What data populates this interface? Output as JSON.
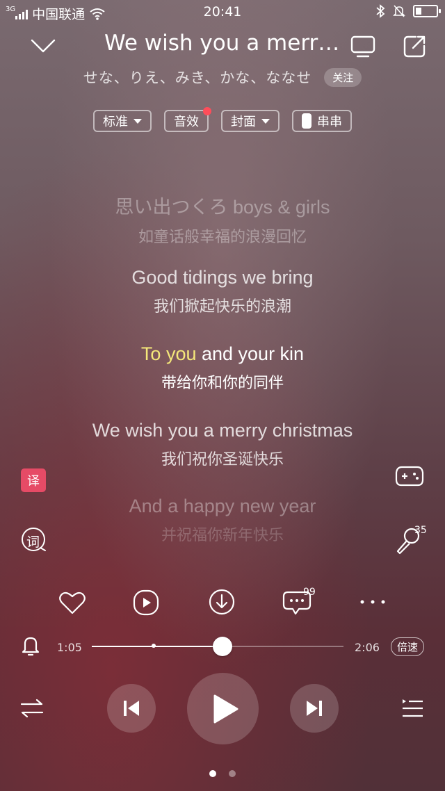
{
  "status": {
    "network": "3G",
    "carrier": "中国联通",
    "time": "20:41",
    "battery_level": 0.3
  },
  "header": {
    "title": "We wish you a merry christmas",
    "artist": "せな、りえ、みき、かな、ななせ",
    "follow_label": "关注"
  },
  "chips": {
    "quality": "标准",
    "effect": "音效",
    "cover": "封面",
    "chuanchuan": "串串"
  },
  "lyrics": [
    {
      "en": "思い出つくろ boys & girls",
      "zh": "如童话般幸福的浪漫回忆"
    },
    {
      "en": "Good tidings we bring",
      "zh": "我们掀起快乐的浪潮"
    },
    {
      "en_hl": "To you",
      "en_rest": " and your kin",
      "zh": "带给你和你的同伴"
    },
    {
      "en": "We wish you a merry christmas",
      "zh": "我们祝你圣诞快乐"
    },
    {
      "en": "And a happy new year",
      "zh": "并祝福你新年快乐"
    }
  ],
  "side": {
    "translate_label": "译",
    "ci_label": "词",
    "mic_count": "35"
  },
  "actions": {
    "comment_count": "99"
  },
  "progress": {
    "current": "1:05",
    "total": "2:06",
    "fraction": 0.52,
    "buffered_fraction": 0.245,
    "speed_label": "倍速"
  },
  "pager": {
    "pages": 2,
    "current": 0
  }
}
